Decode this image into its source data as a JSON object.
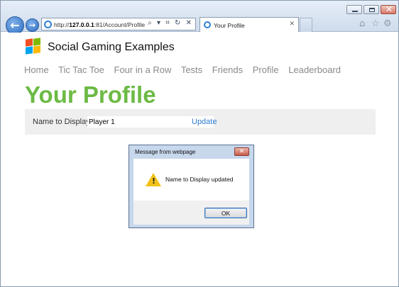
{
  "browser": {
    "url_prefix": "http://",
    "url_host": "127.0.0.1",
    "url_rest": ":81/Account/Profile",
    "tab_title": "Your Profile",
    "address_tools": "⌕ ▾ ⌗ ↻ ✕",
    "tab_close": "✕",
    "icons": [
      "back-arrow-icon",
      "forward-arrow-icon",
      "ie-icon",
      "home-icon",
      "star-icon",
      "gear-icon"
    ],
    "back_glyph": "←",
    "forward_glyph": "→",
    "home_glyph": "⌂",
    "star_glyph": "☆",
    "gear_glyph": "⚙",
    "close_glyph": "✕"
  },
  "site": {
    "title": "Social Gaming Examples",
    "nav": [
      "Home",
      "Tic Tac Toe",
      "Four in a Row",
      "Tests",
      "Friends",
      "Profile",
      "Leaderboard"
    ],
    "accent_color": "#6cba45"
  },
  "main": {
    "heading": "Your Profile",
    "name_label": "Name to Display",
    "name_value": "Player 1",
    "update_label": "Update",
    "link_color": "#2d7bd0"
  },
  "dialog": {
    "title": "Message from webpage",
    "message": "Name to Display updated",
    "ok_label": "OK",
    "close_glyph": "✕",
    "warning_glyph": "!"
  }
}
